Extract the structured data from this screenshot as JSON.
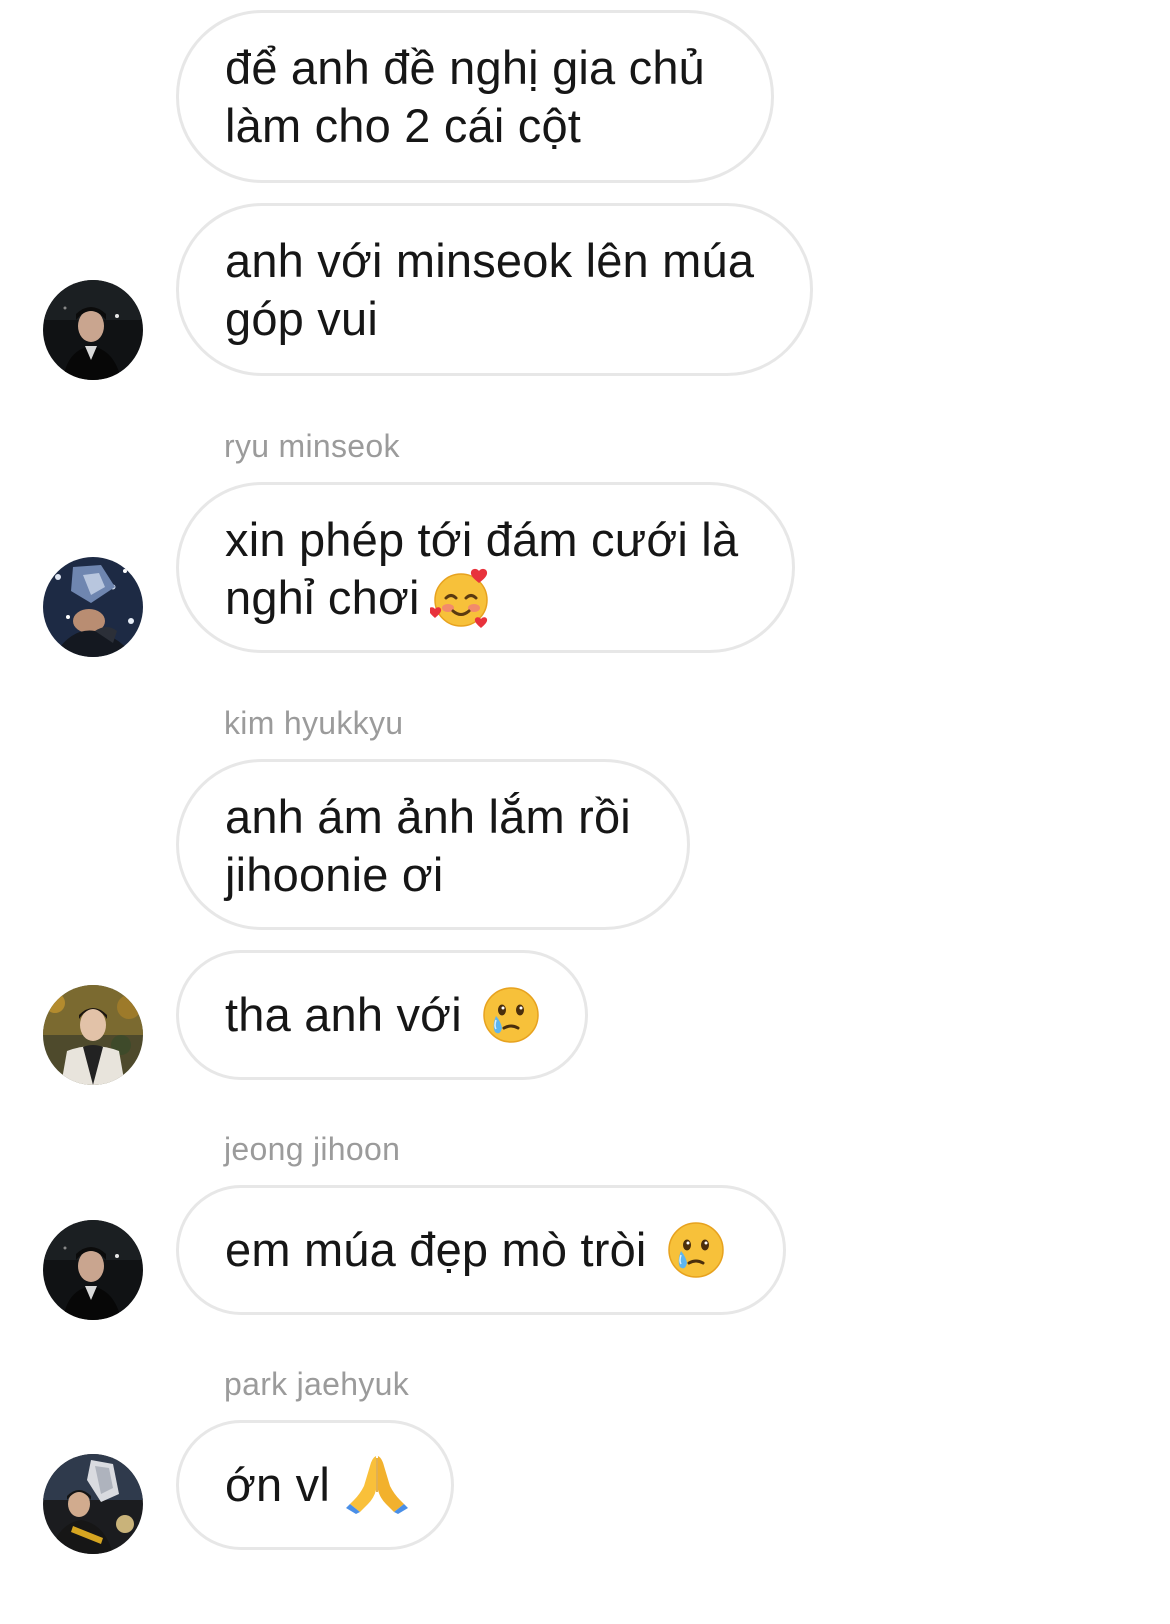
{
  "messages": [
    {
      "lines": [
        "để anh đề nghị gia chủ",
        "làm cho 2 cái cột"
      ]
    },
    {
      "lines": [
        "anh với minseok lên múa",
        "góp vui"
      ]
    },
    {
      "sender": "ryu minseok",
      "lines": [
        "xin phép tới đám cưới là",
        "nghỉ chơi"
      ],
      "emoji": "smiling-face-with-hearts"
    },
    {
      "sender": "kim hyukkyu",
      "lines": [
        "anh ám ảnh lắm rồi",
        "jihoonie ơi"
      ]
    },
    {
      "lines": [
        "tha anh với"
      ],
      "emoji": "face-holding-back-tears"
    },
    {
      "sender": "jeong jihoon",
      "lines": [
        "em múa đẹp mò tròi"
      ],
      "emoji": "face-holding-back-tears"
    },
    {
      "sender": "park jaehyuk",
      "lines": [
        "ớn vl"
      ],
      "emoji": "folded-hands"
    }
  ],
  "colors": {
    "bubble_border": "#e7e7e7",
    "sender_text": "#9b9b9b",
    "message_text": "#161616"
  }
}
